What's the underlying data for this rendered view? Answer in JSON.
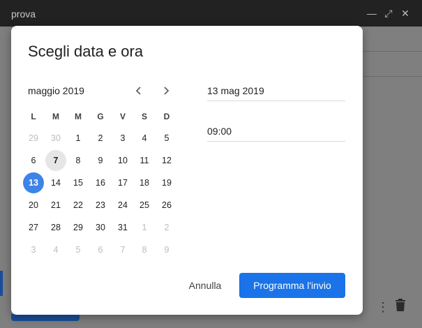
{
  "window": {
    "title": "prova"
  },
  "dialog": {
    "title": "Scegli data e ora",
    "month_label": "maggio 2019",
    "weekdays": [
      "L",
      "M",
      "M",
      "G",
      "V",
      "S",
      "D"
    ],
    "weeks": [
      [
        "29",
        "30",
        "1",
        "2",
        "3",
        "4",
        "5"
      ],
      [
        "6",
        "7",
        "8",
        "9",
        "10",
        "11",
        "12"
      ],
      [
        "13",
        "14",
        "15",
        "16",
        "17",
        "18",
        "19"
      ],
      [
        "20",
        "21",
        "22",
        "23",
        "24",
        "25",
        "26"
      ],
      [
        "27",
        "28",
        "29",
        "30",
        "31",
        "1",
        "2"
      ],
      [
        "3",
        "4",
        "5",
        "6",
        "7",
        "8",
        "9"
      ]
    ],
    "date_value": "13 mag 2019",
    "time_value": "09:00",
    "cancel_label": "Annulla",
    "confirm_label": "Programma l'invio",
    "today_day": "7",
    "selected_day": "13"
  },
  "colors": {
    "accent": "#1a73e8",
    "selected": "#3d84e8",
    "today_bg": "#e6e6e6"
  },
  "icons": [
    "minimize-icon",
    "expand-icon",
    "close-icon",
    "chevron-left-icon",
    "chevron-right-icon",
    "more-vert-icon",
    "trash-icon"
  ]
}
